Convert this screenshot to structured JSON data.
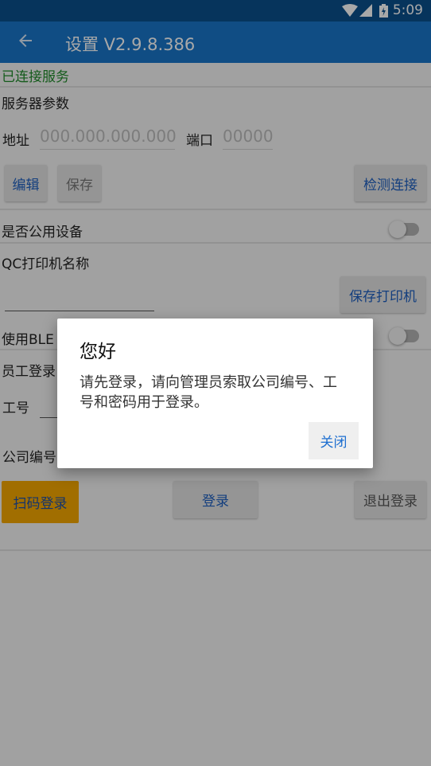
{
  "status_bar": {
    "time": "5:09"
  },
  "app_bar": {
    "title": "设置 V2.9.8.386"
  },
  "connection_status": "已连接服务",
  "server": {
    "section_title": "服务器参数",
    "address_label": "地址",
    "address_placeholder": "000.000.000.000",
    "port_label": "端口",
    "port_placeholder": "00000",
    "edit_label": "编辑",
    "save_label": "保存",
    "test_label": "检测连接"
  },
  "public_device": {
    "label": "是否公用设备",
    "on": false
  },
  "printer": {
    "label": "QC打印机名称",
    "save_label": "保存打印机"
  },
  "ble": {
    "label": "使用BLE",
    "on": false
  },
  "employee": {
    "section_title": "员工登录",
    "id_label": "工号",
    "company_label": "公司编号",
    "scan_login_label": "扫码登录",
    "login_label": "登录",
    "logout_label": "退出登录"
  },
  "dialog": {
    "title": "您好",
    "message": "请先登录，请向管理员索取公司编号、工号和密码用于登录。",
    "close_label": "关闭"
  },
  "colors": {
    "status_bar": "#0a4f8c",
    "app_bar": "#1976c8",
    "connected_text": "#1f8a2a",
    "scan_button": "#f4a800"
  }
}
